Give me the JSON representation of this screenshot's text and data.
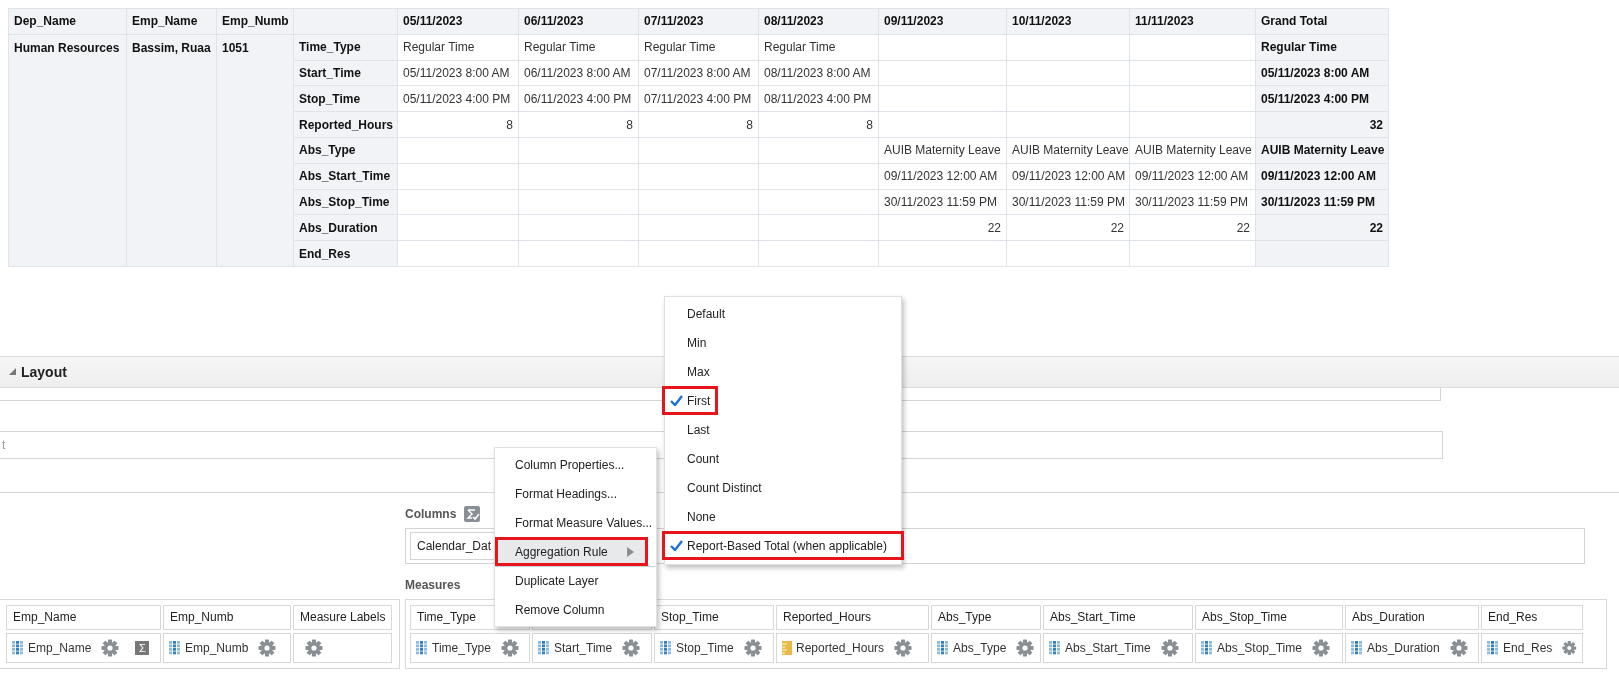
{
  "pivot_table": {
    "dimension_columns": [
      "Dep_Name",
      "Emp_Name",
      "Emp_Numb"
    ],
    "date_columns": [
      "05/11/2023",
      "06/11/2023",
      "07/11/2023",
      "08/11/2023",
      "09/11/2023",
      "10/11/2023",
      "11/11/2023"
    ],
    "total_column": "Grand Total",
    "dep_name": "Human Resources",
    "emp_name": "Bassim, Ruaa",
    "emp_numb": "1051",
    "rows": [
      {
        "label": "Time_Type",
        "kind": "text",
        "cells": [
          "Regular Time",
          "Regular Time",
          "Regular Time",
          "Regular Time",
          null,
          null,
          null
        ],
        "total": "Regular Time"
      },
      {
        "label": "Start_Time",
        "kind": "text",
        "cells": [
          "05/11/2023 8:00 AM",
          "06/11/2023 8:00 AM",
          "07/11/2023 8:00 AM",
          "08/11/2023 8:00 AM",
          null,
          null,
          null
        ],
        "total": "05/11/2023 8:00 AM"
      },
      {
        "label": "Stop_Time",
        "kind": "text",
        "cells": [
          "05/11/2023 4:00 PM",
          "06/11/2023 4:00 PM",
          "07/11/2023 4:00 PM",
          "08/11/2023 4:00 PM",
          null,
          null,
          null
        ],
        "total": "05/11/2023 4:00 PM"
      },
      {
        "label": "Reported_Hours",
        "kind": "number",
        "cells": [
          "8",
          "8",
          "8",
          "8",
          null,
          null,
          null
        ],
        "total": "32"
      },
      {
        "label": "Abs_Type",
        "kind": "text",
        "cells": [
          null,
          null,
          null,
          null,
          "AUIB Maternity Leave",
          "AUIB Maternity Leave",
          "AUIB Maternity Leave"
        ],
        "total": "AUIB Maternity Leave"
      },
      {
        "label": "Abs_Start_Time",
        "kind": "text",
        "cells": [
          null,
          null,
          null,
          null,
          "09/11/2023 12:00 AM",
          "09/11/2023 12:00 AM",
          "09/11/2023 12:00 AM"
        ],
        "total": "09/11/2023 12:00 AM"
      },
      {
        "label": "Abs_Stop_Time",
        "kind": "text",
        "cells": [
          null,
          null,
          null,
          null,
          "30/11/2023 11:59 PM",
          "30/11/2023 11:59 PM",
          "30/11/2023 11:59 PM"
        ],
        "total": "30/11/2023 11:59 PM"
      },
      {
        "label": "Abs_Duration",
        "kind": "number",
        "cells": [
          null,
          null,
          null,
          null,
          "22",
          "22",
          "22"
        ],
        "total": "22"
      },
      {
        "label": "End_Res",
        "kind": "number",
        "cells": [
          null,
          null,
          null,
          null,
          null,
          null,
          null
        ]
      }
    ]
  },
  "layout_panel": {
    "title": "Layout",
    "expanded": true,
    "field_text": "t",
    "columns_label": "Columns",
    "columns_items": [
      "Calendar_Dat"
    ],
    "measures_label": "Measures",
    "row_edge": [
      {
        "header": "Emp_Name",
        "item": "Emp_Name",
        "totals_icon": "Σ"
      },
      {
        "header": "Emp_Numb",
        "item": "Emp_Numb"
      },
      {
        "header": "Measure Labels"
      }
    ],
    "measures": [
      {
        "header": "Time_Type",
        "item": "Time_Type",
        "kind": "attribute"
      },
      {
        "item": "Start_Time",
        "kind": "attribute"
      },
      {
        "header": "Stop_Time",
        "item": "Stop_Time",
        "kind": "attribute"
      },
      {
        "header": "Reported_Hours",
        "item": "Reported_Hours",
        "kind": "measure"
      },
      {
        "header": "Abs_Type",
        "item": "Abs_Type",
        "kind": "attribute"
      },
      {
        "header": "Abs_Start_Time",
        "item": "Abs_Start_Time",
        "kind": "attribute"
      },
      {
        "header": "Abs_Stop_Time",
        "item": "Abs_Stop_Time",
        "kind": "attribute"
      },
      {
        "header": "Abs_Duration",
        "item": "Abs_Duration",
        "kind": "attribute"
      },
      {
        "header": "End_Res",
        "item": "End_Res",
        "kind": "attribute"
      }
    ]
  },
  "context_menu": {
    "items": [
      {
        "label": "Column Properties...",
        "active": false,
        "highlighted": false,
        "submenu": false,
        "separator_before": false
      },
      {
        "label": "Format Headings...",
        "active": false,
        "highlighted": false,
        "submenu": false,
        "separator_before": false
      },
      {
        "label": "Format Measure Values...",
        "active": false,
        "highlighted": false,
        "submenu": false,
        "separator_before": false
      },
      {
        "label": "Aggregation Rule",
        "active": true,
        "highlighted": true,
        "submenu": true,
        "separator_before": false
      },
      {
        "label": "Duplicate Layer",
        "active": false,
        "highlighted": false,
        "submenu": false,
        "separator_before": true
      },
      {
        "label": "Remove Column",
        "active": false,
        "highlighted": false,
        "submenu": false,
        "separator_before": false
      }
    ]
  },
  "aggregation_menu": {
    "items": [
      {
        "label": "Default",
        "checked": false,
        "highlighted": false
      },
      {
        "label": "Min",
        "checked": false,
        "highlighted": false
      },
      {
        "label": "Max",
        "checked": false,
        "highlighted": false
      },
      {
        "label": "First",
        "checked": true,
        "highlighted": true
      },
      {
        "label": "Last",
        "checked": false,
        "highlighted": false
      },
      {
        "label": "Count",
        "checked": false,
        "highlighted": false
      },
      {
        "label": "Count Distinct",
        "checked": false,
        "highlighted": false
      },
      {
        "label": "None",
        "checked": false,
        "highlighted": false
      },
      {
        "label": "Report-Based Total (when applicable)",
        "checked": true,
        "highlighted": true
      }
    ]
  }
}
